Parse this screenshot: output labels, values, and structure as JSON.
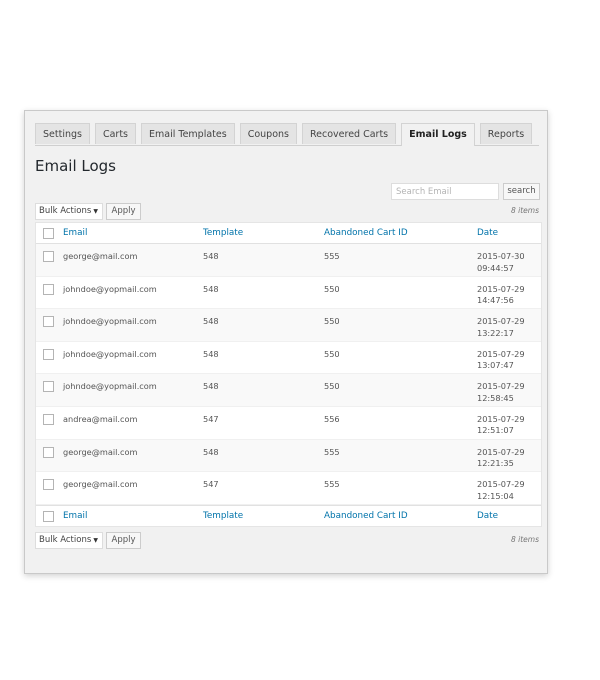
{
  "tabs": [
    {
      "label": "Settings",
      "active": false
    },
    {
      "label": "Carts",
      "active": false
    },
    {
      "label": "Email Templates",
      "active": false
    },
    {
      "label": "Coupons",
      "active": false
    },
    {
      "label": "Recovered Carts",
      "active": false
    },
    {
      "label": "Email Logs",
      "active": true
    },
    {
      "label": "Reports",
      "active": false
    }
  ],
  "page_title": "Email Logs",
  "search": {
    "placeholder": "Search Email",
    "value": "",
    "button_label": "search"
  },
  "items_count": "8 items",
  "bulk_actions": {
    "selected": "Bulk Actions",
    "caret": "▼",
    "apply_label": "Apply"
  },
  "table": {
    "columns": [
      "Email",
      "Template",
      "Abandoned Cart ID",
      "Date"
    ],
    "rows": [
      {
        "email": "george@mail.com",
        "template": "548",
        "cart_id": "555",
        "date": "2015-07-30",
        "time": "09:44:57"
      },
      {
        "email": "johndoe@yopmail.com",
        "template": "548",
        "cart_id": "550",
        "date": "2015-07-29",
        "time": "14:47:56"
      },
      {
        "email": "johndoe@yopmail.com",
        "template": "548",
        "cart_id": "550",
        "date": "2015-07-29",
        "time": "13:22:17"
      },
      {
        "email": "johndoe@yopmail.com",
        "template": "548",
        "cart_id": "550",
        "date": "2015-07-29",
        "time": "13:07:47"
      },
      {
        "email": "johndoe@yopmail.com",
        "template": "548",
        "cart_id": "550",
        "date": "2015-07-29",
        "time": "12:58:45"
      },
      {
        "email": "andrea@mail.com",
        "template": "547",
        "cart_id": "556",
        "date": "2015-07-29",
        "time": "12:51:07"
      },
      {
        "email": "george@mail.com",
        "template": "548",
        "cart_id": "555",
        "date": "2015-07-29",
        "time": "12:21:35"
      },
      {
        "email": "george@mail.com",
        "template": "547",
        "cart_id": "555",
        "date": "2015-07-29",
        "time": "12:15:04"
      }
    ]
  }
}
